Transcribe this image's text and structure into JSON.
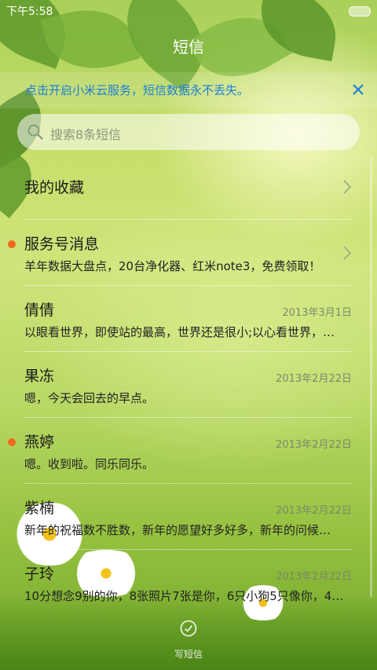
{
  "status_bar": {
    "time": "下午5:58"
  },
  "header": {
    "title": "短信"
  },
  "cloud_banner": {
    "text": "点击开启小米云服务，短信数据永不丢失。",
    "close_icon": "close-icon"
  },
  "search": {
    "placeholder": "搜索8条短信",
    "icon": "search-icon"
  },
  "favorites": {
    "label": "我的收藏"
  },
  "conversations": [
    {
      "title": "服务号消息",
      "preview": "羊年数据大盘点，20台净化器、红米note3，免费领取！",
      "date": "",
      "unread": true,
      "chevron": true
    },
    {
      "title": "倩倩",
      "preview": "以眼看世界，即使站的最高，世界还是很小;以心看世界，…",
      "date": "2013年3月1日",
      "unread": false,
      "chevron": false
    },
    {
      "title": "果冻",
      "preview": "嗯，今天会回去的早点。",
      "date": "2013年2月22日",
      "unread": false,
      "chevron": false
    },
    {
      "title": "燕婷",
      "preview": "嗯。收到啦。同乐同乐。",
      "date": "2013年2月22日",
      "unread": true,
      "chevron": false
    },
    {
      "title": "紫楠",
      "preview": "新年的祝福数不胜数，新年的愿望好多好多，新年的问候…",
      "date": "2013年2月22日",
      "unread": false,
      "chevron": false
    },
    {
      "title": "子玲",
      "preview": "10分想念9别的你，8张照片7张是你，6只小狗5只像你，4…",
      "date": "2013年2月22日",
      "unread": false,
      "chevron": false
    }
  ],
  "compose": {
    "label": "写短信",
    "icon": "compose-icon"
  },
  "colors": {
    "accent": "#1e7fd8",
    "unread": "#f26a1b"
  }
}
